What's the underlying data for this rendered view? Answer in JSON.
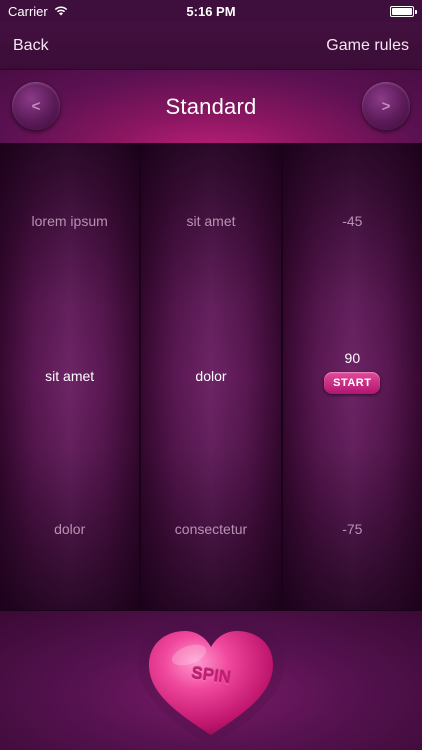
{
  "status_bar": {
    "carrier": "Carrier",
    "time": "5:16 PM",
    "battery_level": 1.0
  },
  "nav": {
    "back_label": "Back",
    "rules_label": "Game rules"
  },
  "mode": {
    "title": "Standard",
    "prev_glyph": "<",
    "next_glyph": ">"
  },
  "wheels": [
    {
      "top": "lorem ipsum",
      "mid": "sit amet",
      "bot": "dolor"
    },
    {
      "top": "sit amet",
      "mid": "dolor",
      "bot": "consectetur"
    },
    {
      "top": "-45",
      "mid": "90",
      "bot": "-75",
      "action_label": "START"
    }
  ],
  "spin": {
    "label": "SPIN"
  },
  "colors": {
    "accent": "#c41b74",
    "background": "#2a0a2a"
  }
}
